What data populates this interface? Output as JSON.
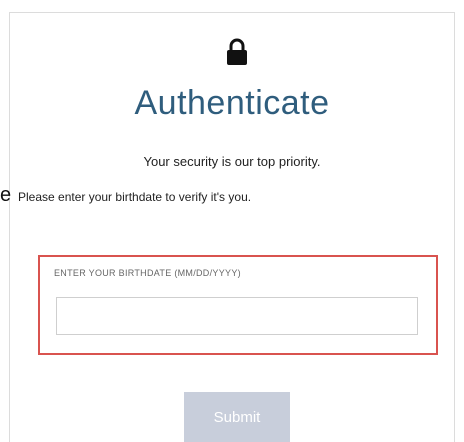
{
  "page": {
    "title": "Authenticate",
    "subtitle_line1": "Your security is our top priority.",
    "subtitle_line2": "Please enter your birthdate to verify it's you.",
    "stray_letter": "e"
  },
  "icons": {
    "lock": "lock-icon"
  },
  "form": {
    "birthdate_label": "ENTER YOUR BIRTHDATE (MM/DD/YYYY)",
    "birthdate_value": "",
    "submit_label": "Submit"
  },
  "colors": {
    "title": "#2f5d7d",
    "field_border": "#d9534f",
    "submit_bg": "#c8cedb"
  }
}
